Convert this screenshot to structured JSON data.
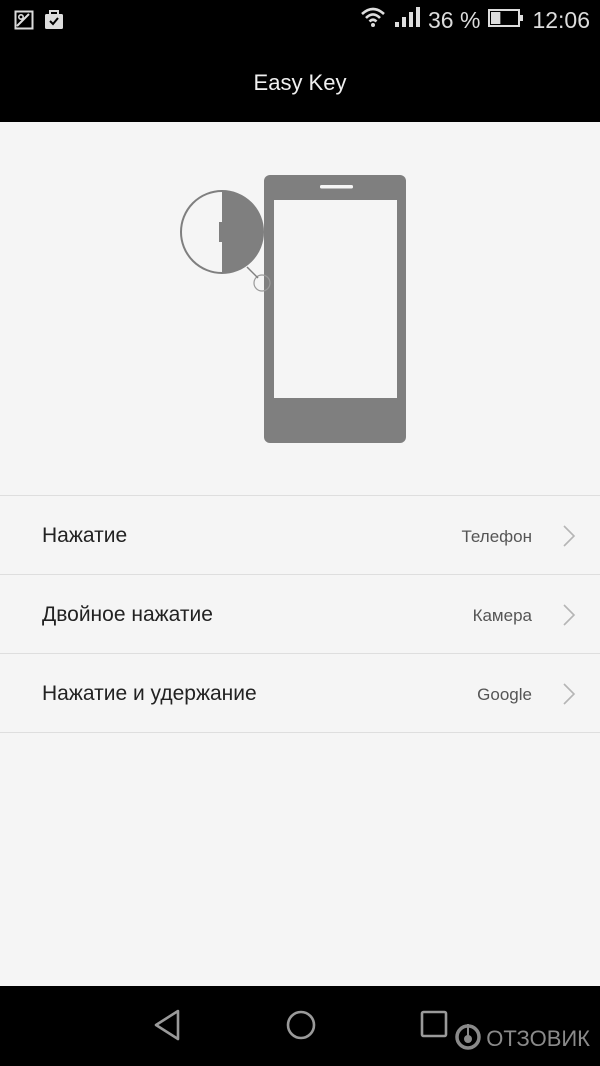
{
  "status_bar": {
    "left_icons": [
      "image-icon",
      "clipboard-check-icon"
    ],
    "wifi_icon": "wifi-icon",
    "signal_icon": "signal-icon",
    "battery_percent": "36 %",
    "battery_level": 0.36,
    "time": "12:06"
  },
  "header": {
    "title": "Easy Key"
  },
  "illustration": {
    "description": "phone-with-side-key-magnifier",
    "color": "#7f7f7f"
  },
  "settings": {
    "items": [
      {
        "label": "Нажатие",
        "value": "Телефон"
      },
      {
        "label": "Двойное нажатие",
        "value": "Камера"
      },
      {
        "label": "Нажатие и удержание",
        "value": "Google"
      }
    ]
  },
  "nav_bar": {
    "back": "back-icon",
    "home": "home-icon",
    "recents": "recents-icon"
  },
  "watermark": {
    "text": "ОТЗОВИК"
  }
}
